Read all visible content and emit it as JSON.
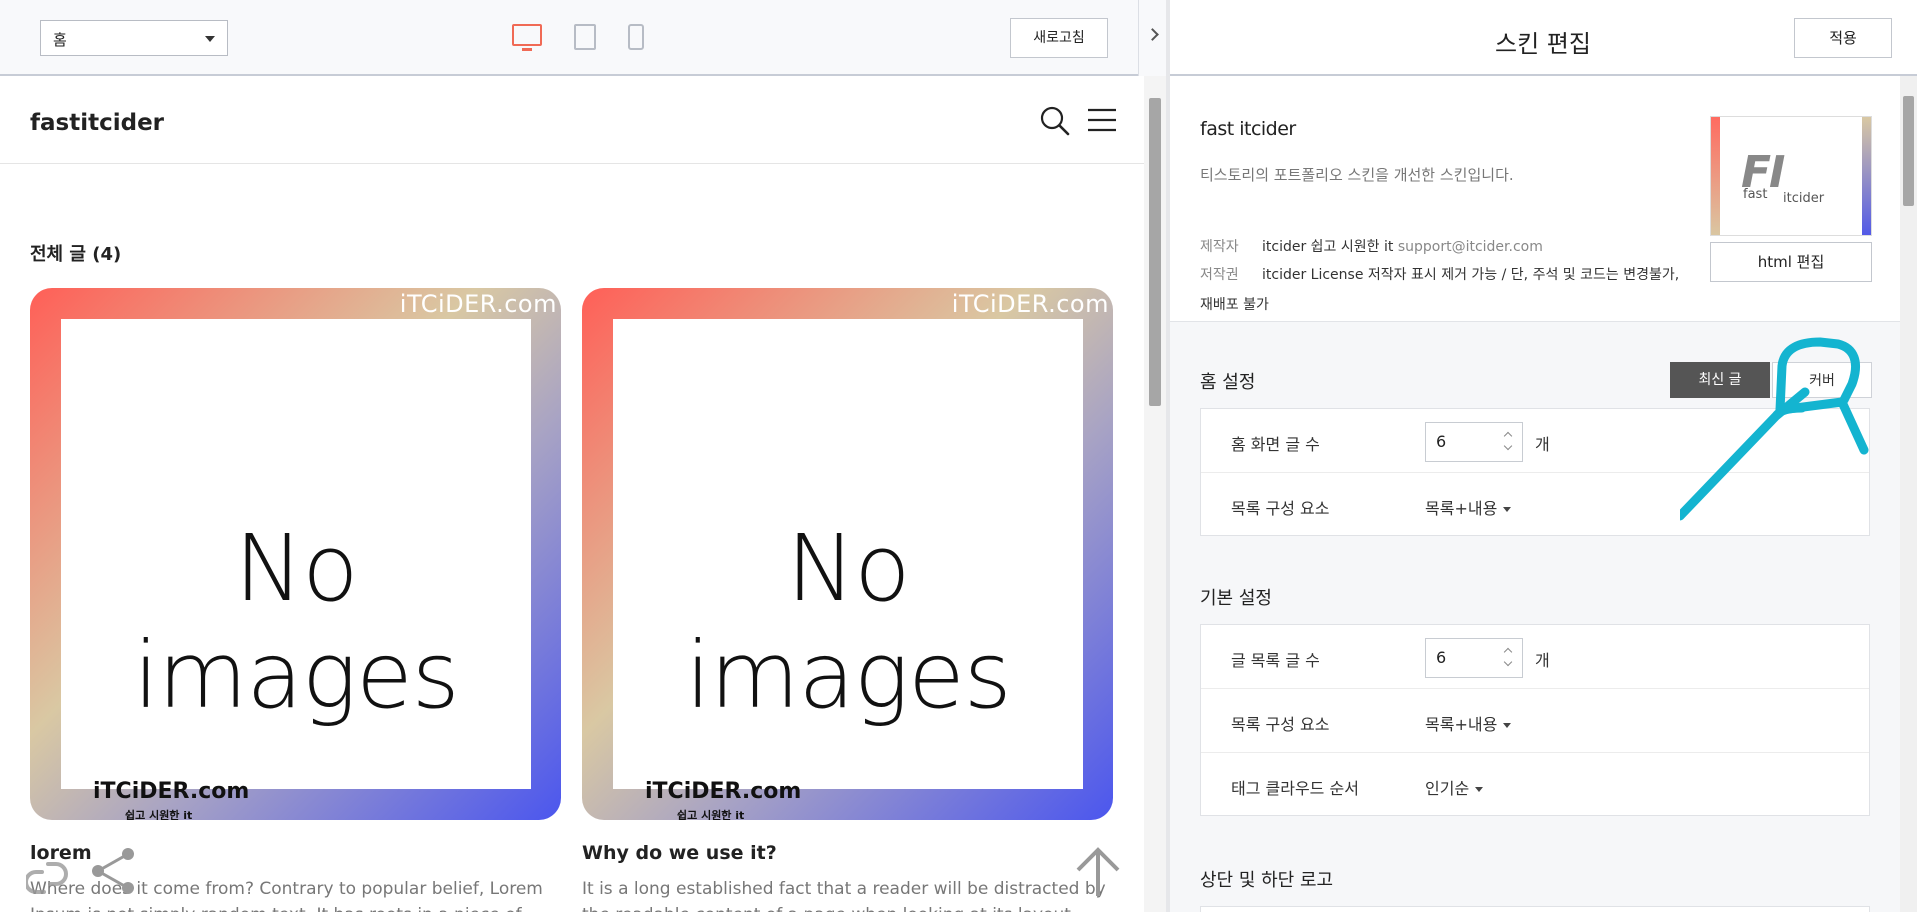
{
  "toolbar": {
    "page_select_value": "홈",
    "refresh_label": "새로고침"
  },
  "blog": {
    "title": "fastitcider",
    "section_title": "전체 글 (4)",
    "posts": [
      {
        "image_text": "No images",
        "watermark": "iTCiDER.com",
        "logo_text": "iTCiDER.com",
        "logo_sub": "쉽고 시원한 it",
        "title": "lorem",
        "excerpt": "Where does it come from? Contrary to popular belief, Lorem Ipsum is not simply random text. It has roots in a piece of"
      },
      {
        "image_text": "No images",
        "watermark": "iTCiDER.com",
        "logo_text": "iTCiDER.com",
        "logo_sub": "쉽고 시원한 it",
        "title": "Why do we use it?",
        "excerpt": "It is a long established fact that a reader will be distracted by the readable content of a page when looking at its layout. The"
      }
    ]
  },
  "panel": {
    "title": "스킨 편집",
    "apply_label": "적용",
    "skin_name": "fast itcider",
    "skin_desc": "티스토리의 포트폴리오 스킨을 개선한 스킨입니다.",
    "maker_label": "제작자",
    "maker_value": "itcider 쉽고 시원한 it",
    "maker_email": "support@itcider.com",
    "license_label": "저작권",
    "license_value_1": "itcider License 저작자 표시 제거 가능 / 단, 주석 및 코드는 변경불가,",
    "license_value_2": "재배포 불가",
    "thumb_logo": "FI",
    "thumb_fast": "fast",
    "thumb_itcider": "itcider",
    "html_edit_label": "html 편집",
    "home": {
      "title": "홈 설정",
      "seg_latest": "최신 글",
      "seg_cover": "커버",
      "post_count_label": "홈 화면 글 수",
      "post_count_value": "6",
      "unit": "개",
      "list_comp_label": "목록 구성 요소",
      "list_comp_value": "목록+내용"
    },
    "basic": {
      "title": "기본 설정",
      "list_count_label": "글 목록 글 수",
      "list_count_value": "6",
      "unit": "개",
      "list_comp_label": "목록 구성 요소",
      "list_comp_value": "목록+내용",
      "tag_order_label": "태그 클라우드 순서",
      "tag_order_value": "인기순"
    },
    "logo_section_title": "상단 및 하단 로고"
  },
  "colors": {
    "accent_device": "#f06a55",
    "annotation": "#14b4d0",
    "segment_active": "#555555"
  }
}
